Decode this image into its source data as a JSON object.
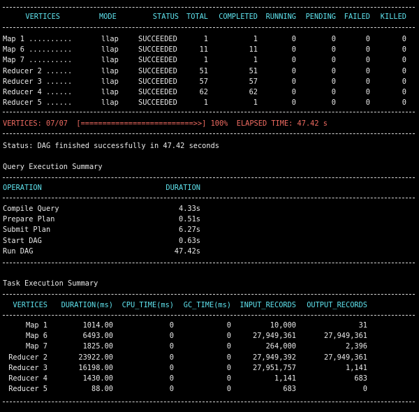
{
  "vertices_table": {
    "headers": [
      "VERTICES",
      "MODE",
      "STATUS",
      "TOTAL",
      "COMPLETED",
      "RUNNING",
      "PENDING",
      "FAILED",
      "KILLED"
    ],
    "rows": [
      [
        "Map 1 ..........",
        "llap",
        "SUCCEEDED",
        "1",
        "1",
        "0",
        "0",
        "0",
        "0"
      ],
      [
        "Map 6 ..........",
        "llap",
        "SUCCEEDED",
        "11",
        "11",
        "0",
        "0",
        "0",
        "0"
      ],
      [
        "Map 7 ..........",
        "llap",
        "SUCCEEDED",
        "1",
        "1",
        "0",
        "0",
        "0",
        "0"
      ],
      [
        "Reducer 2 ......",
        "llap",
        "SUCCEEDED",
        "51",
        "51",
        "0",
        "0",
        "0",
        "0"
      ],
      [
        "Reducer 3 ......",
        "llap",
        "SUCCEEDED",
        "57",
        "57",
        "0",
        "0",
        "0",
        "0"
      ],
      [
        "Reducer 4 ......",
        "llap",
        "SUCCEEDED",
        "62",
        "62",
        "0",
        "0",
        "0",
        "0"
      ],
      [
        "Reducer 5 ......",
        "llap",
        "SUCCEEDED",
        "1",
        "1",
        "0",
        "0",
        "0",
        "0"
      ]
    ]
  },
  "progress": {
    "line": "VERTICES: 07/07  [==========================>>] 100%  ELAPSED TIME: 47.42 s",
    "percent": 100
  },
  "status_line": "Status: DAG finished successfully in 47.42 seconds",
  "query_summary": {
    "title": "Query Execution Summary",
    "headers": [
      "OPERATION",
      "DURATION"
    ],
    "rows": [
      [
        "Compile Query",
        "4.33s"
      ],
      [
        "Prepare Plan",
        "0.51s"
      ],
      [
        "Submit Plan",
        "6.27s"
      ],
      [
        "Start DAG",
        "0.63s"
      ],
      [
        "Run DAG",
        "47.42s"
      ]
    ]
  },
  "task_summary": {
    "title": "Task Execution Summary",
    "headers": [
      "VERTICES",
      "DURATION(ms)",
      "CPU_TIME(ms)",
      "GC_TIME(ms)",
      "INPUT_RECORDS",
      "OUTPUT_RECORDS"
    ],
    "rows": [
      [
        "Map 1",
        "1014.00",
        "0",
        "0",
        "10,000",
        "31"
      ],
      [
        "Map 6",
        "6493.00",
        "0",
        "0",
        "27,949,361",
        "27,949,361"
      ],
      [
        "Map 7",
        "1825.00",
        "0",
        "0",
        "264,000",
        "2,396"
      ],
      [
        "Reducer 2",
        "23922.00",
        "0",
        "0",
        "27,949,392",
        "27,949,361"
      ],
      [
        "Reducer 3",
        "16198.00",
        "0",
        "0",
        "27,951,757",
        "1,141"
      ],
      [
        "Reducer 4",
        "1430.00",
        "0",
        "0",
        "1,141",
        "683"
      ],
      [
        "Reducer 5",
        "88.00",
        "0",
        "0",
        "683",
        "0"
      ]
    ]
  },
  "colors": {
    "background": "#000000",
    "text": "#e8e8e8",
    "header": "#5fe3ee",
    "progress": "#ef6b61"
  }
}
